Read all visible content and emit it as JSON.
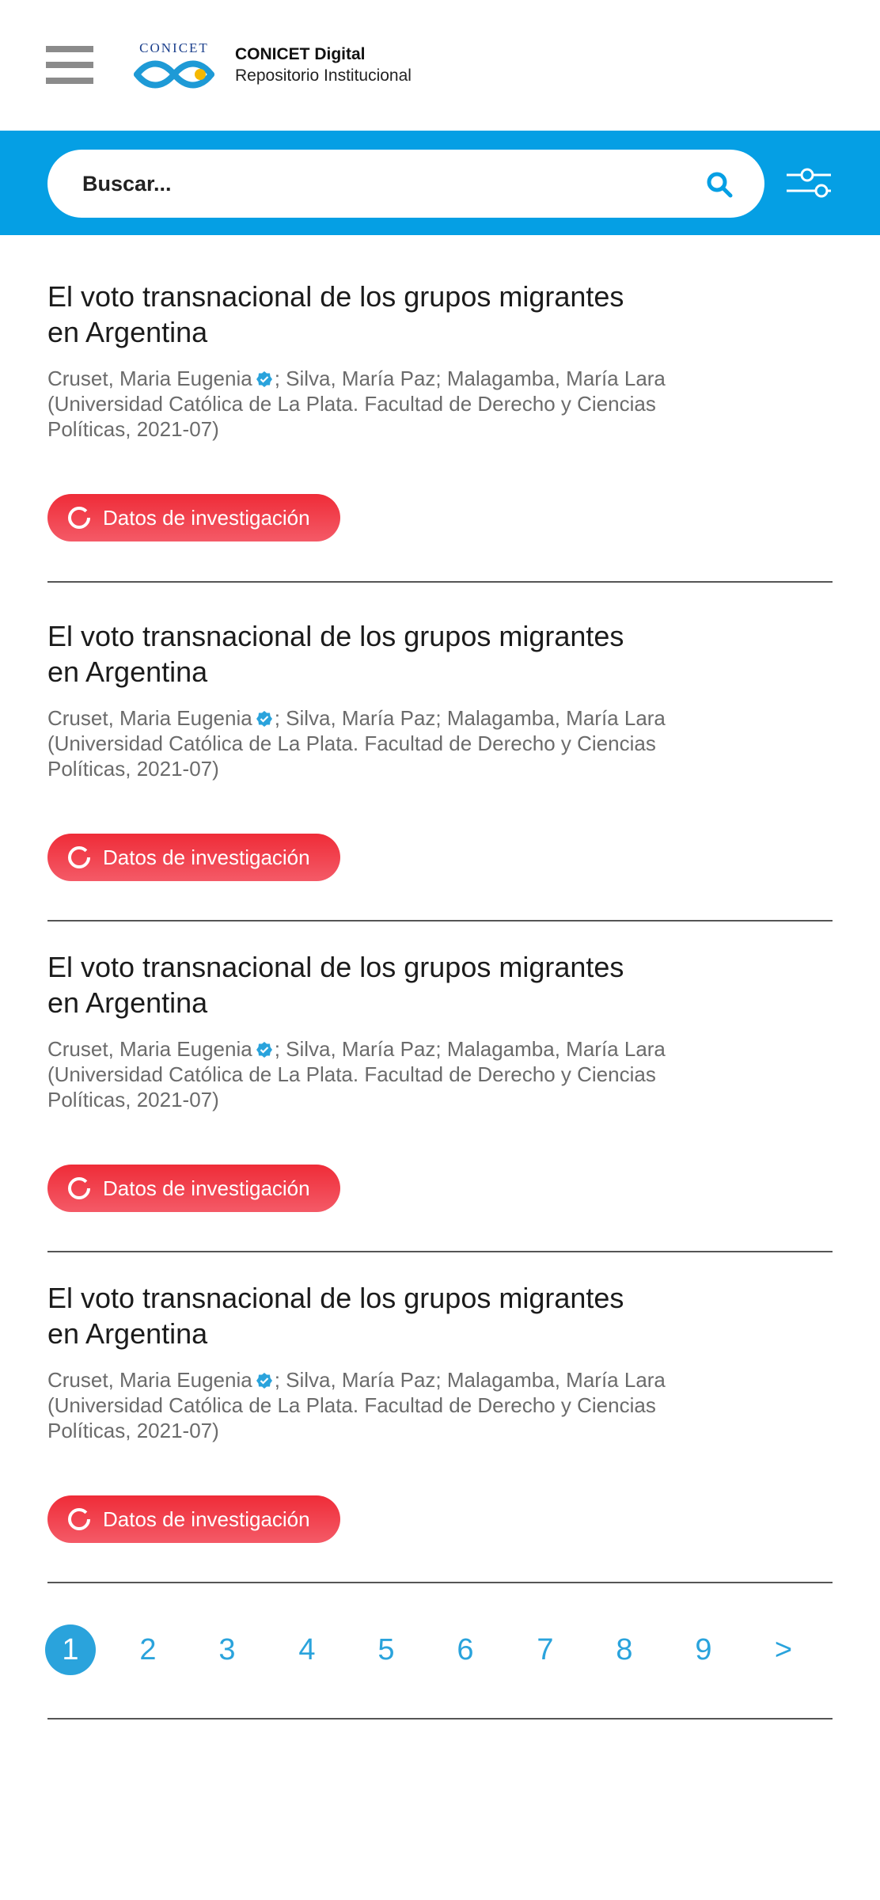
{
  "header": {
    "logo_text": "CONICET",
    "brand_title": "CONICET Digital",
    "brand_subtitle": "Repositorio Institucional"
  },
  "search": {
    "placeholder": "Buscar..."
  },
  "colors": {
    "accent": "#059fe4",
    "badge": "#ef2c38",
    "link": "#2aa3dc"
  },
  "results": [
    {
      "title_line1": "El voto transnacional de los grupos migrantes",
      "title_line2": "en Argentina",
      "author_verified": "Cruset, Maria Eugenia",
      "authors_rest": "; Silva, María Paz; Malagamba, María Lara",
      "source": "(Universidad Católica de La Plata. Facultad de Derecho y Ciencias Políticas, 2021-07)",
      "badge": "Datos de investigación"
    },
    {
      "title_line1": "El voto transnacional de los grupos migrantes",
      "title_line2": "en Argentina",
      "author_verified": "Cruset, Maria Eugenia",
      "authors_rest": "; Silva, María Paz; Malagamba, María Lara",
      "source": "(Universidad Católica de La Plata. Facultad de Derecho y Ciencias Políticas, 2021-07)",
      "badge": "Datos de investigación"
    },
    {
      "title_line1": "El voto transnacional de los grupos migrantes",
      "title_line2": "en Argentina",
      "author_verified": "Cruset, Maria Eugenia",
      "authors_rest": "; Silva, María Paz; Malagamba, María Lara",
      "source": "(Universidad Católica de La Plata. Facultad de Derecho y Ciencias Políticas, 2021-07)",
      "badge": "Datos de investigación"
    },
    {
      "title_line1": "El voto transnacional de los grupos migrantes",
      "title_line2": "en Argentina",
      "author_verified": "Cruset, Maria Eugenia",
      "authors_rest": "; Silva, María Paz; Malagamba, María Lara",
      "source": "(Universidad Católica de La Plata. Facultad de Derecho y Ciencias Políticas, 2021-07)",
      "badge": "Datos de investigación"
    }
  ],
  "pagination": {
    "pages": [
      "1",
      "2",
      "3",
      "4",
      "5",
      "6",
      "7",
      "8",
      "9"
    ],
    "next": ">",
    "current": "1"
  }
}
